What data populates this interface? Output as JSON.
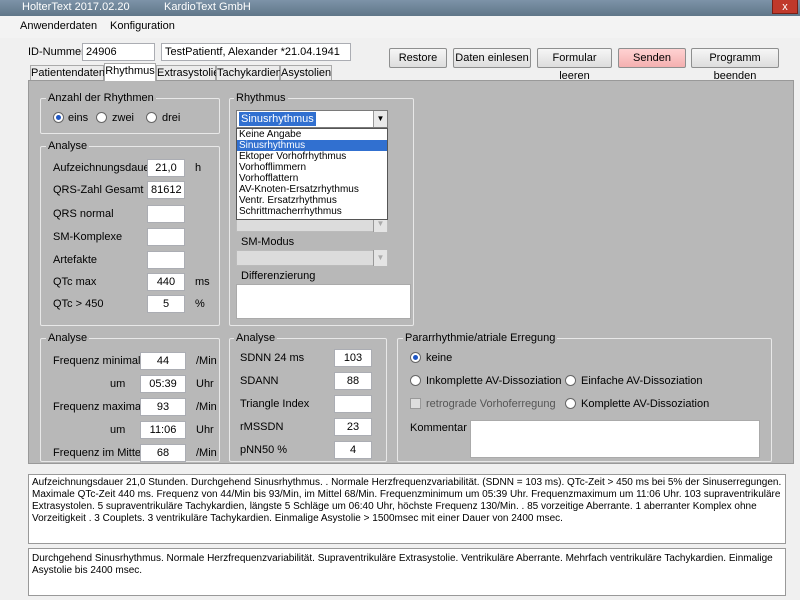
{
  "titlebar": {
    "title": "HolterText 2017.02.20",
    "company": "KardioText GmbH",
    "close_glyph": "x"
  },
  "menu": [
    "Anwenderdaten",
    "Konfiguration"
  ],
  "patient": {
    "id_label": "ID-Nummer",
    "id_value": "24906",
    "name_value": "TestPatientf, Alexander *21.04.1941"
  },
  "toolbar": {
    "restore": "Restore",
    "daten_einlesen": "Daten einlesen",
    "formular_leeren": "Formular leeren",
    "senden": "Senden",
    "programm_beenden": "Programm beenden"
  },
  "tabs": [
    "Patientendaten",
    "Rhythmus",
    "Extrasystolie",
    "Tachykardien",
    "Asystolien"
  ],
  "anzahl": {
    "title": "Anzahl der Rhythmen",
    "options": [
      "eins",
      "zwei",
      "drei"
    ],
    "selected": 0
  },
  "analyse1": {
    "title": "Analyse",
    "rows": [
      {
        "label": "Aufzeichnungsdauer",
        "value": "21,0",
        "unit": "h"
      },
      {
        "label": "QRS-Zahl Gesamt",
        "value": "81612",
        "unit": ""
      },
      {
        "label": "QRS normal",
        "value": "",
        "unit": ""
      },
      {
        "label": "SM-Komplexe",
        "value": "",
        "unit": ""
      },
      {
        "label": "Artefakte",
        "value": "",
        "unit": ""
      },
      {
        "label": "QTc max",
        "value": "440",
        "unit": "ms"
      },
      {
        "label": "QTc > 450",
        "value": "5",
        "unit": "%"
      }
    ]
  },
  "rhythmus": {
    "title": "Rhythmus",
    "selected": "Sinusrhythmus",
    "options": [
      "Keine Angabe",
      "Sinusrhythmus",
      "Ektoper Vorhofrhythmus",
      "Vorhofflimmern",
      "Vorhofflattern",
      "AV-Knoten-Ersatzrhythmus",
      "Ventr. Ersatzrhythmus",
      "Schrittmacherrhythmus"
    ],
    "sm_modus_label": "SM-Modus",
    "differenzierung_label": "Differenzierung"
  },
  "analyse2": {
    "title": "Analyse",
    "rows": [
      {
        "label": "Frequenz minimal",
        "value": "44",
        "unit": "/Min"
      },
      {
        "label": "um",
        "value": "05:39",
        "unit": "Uhr"
      },
      {
        "label": "Frequenz maximal",
        "value": "93",
        "unit": "/Min"
      },
      {
        "label": "um",
        "value": "11:06",
        "unit": "Uhr"
      },
      {
        "label": "Frequenz im Mittel",
        "value": "68",
        "unit": "/Min"
      }
    ]
  },
  "analyse3": {
    "title": "Analyse",
    "rows": [
      {
        "label": "SDNN 24 ms",
        "value": "103"
      },
      {
        "label": "SDANN",
        "value": "88"
      },
      {
        "label": "Triangle Index",
        "value": ""
      },
      {
        "label": "rMSSDN",
        "value": "23"
      },
      {
        "label": "pNN50 %",
        "value": "4"
      }
    ]
  },
  "pararrhythmie": {
    "title": "Pararrhythmie/atriale Erregung",
    "keine": "keine",
    "inkomplette": "Inkomplette AV-Dissoziation",
    "einfache": "Einfache AV-Dissoziation",
    "retrograde": "retrograde Vorhoferregung",
    "komplette": "Komplette AV-Dissoziation",
    "kommentar_label": "Kommentar"
  },
  "report1": "Aufzeichnungsdauer 21,0 Stunden. Durchgehend Sinusrhythmus. . Normale Herzfrequenzvariabilität.  (SDNN = 103 ms). QTc-Zeit > 450 ms bei 5% der Sinuserregungen. Maximale QTc-Zeit 440 ms. Frequenz von 44/Min bis 93/Min, im Mittel 68/Min. Frequenzminimum um 05:39 Uhr. Frequenzmaximum um 11:06 Uhr.  103 supraventrikuläre Extrasystolen. 5 supraventrikuläre Tachykardien, längste 5 Schläge um  06:40 Uhr, höchste Frequenz 130/Min. . 85 vorzeitige Aberrante. 1 aberranter Komplex ohne Vorzeitigkeit . 3 Couplets. 3 ventrikuläre Tachykardien. Einmalige Asystolie > 1500msec mit einer Dauer von 2400 msec.",
  "report2": "Durchgehend Sinusrhythmus. Normale Herzfrequenzvariabilität. Supraventrikuläre Extrasystolie. Ventrikuläre Aberrante. Mehrfach ventrikuläre Tachykardien. Einmalige Asystolie bis 2400 msec."
}
